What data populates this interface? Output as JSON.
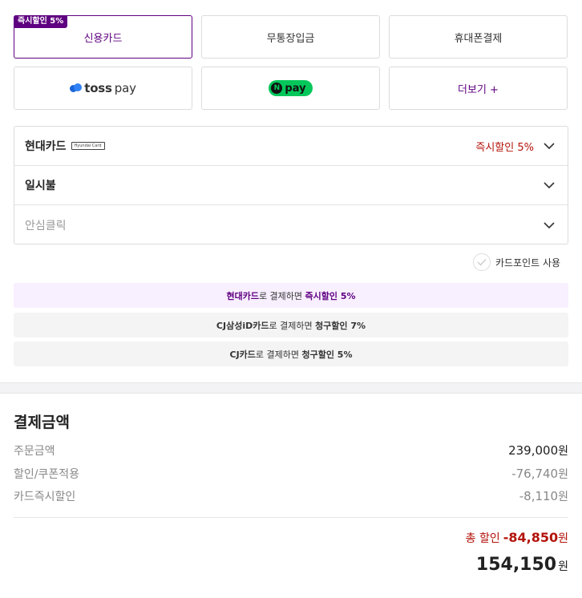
{
  "payment_methods": {
    "credit_card": "신용카드",
    "bank_transfer": "무통장입금",
    "mobile": "휴대폰결제",
    "toss_brand": "toss",
    "toss_suffix": "pay",
    "npay_letter": "N",
    "npay_text": "pay",
    "more": "더보기 +",
    "promo_badge": "즉시할인 5%"
  },
  "card_select": {
    "card_name": "현대카드",
    "card_logo_text": "Hyundai Card",
    "card_promo": "즉시할인 5%",
    "installment": "일시불",
    "auth_placeholder": "안심클릭"
  },
  "card_point": {
    "label": "카드포인트 사용"
  },
  "benefits": [
    {
      "strong1": "현대카드",
      "text1": "로 결제하면 ",
      "strong2": "즉시할인 5%"
    },
    {
      "strong1": "CJ삼성iD카드",
      "text1": "로 결제하면 ",
      "strong2": "청구할인 7%"
    },
    {
      "strong1": "CJ카드",
      "text1": "로 결제하면 ",
      "strong2": "청구할인 5%"
    }
  ],
  "summary": {
    "title": "결제금액",
    "order_label": "주문금액",
    "order_value": "239,000",
    "coupon_label": "할인/쿠폰적용",
    "coupon_value": "-76,740",
    "card_label": "카드즉시할인",
    "card_value": "-8,110",
    "won": "원",
    "total_discount_label": "총 할인",
    "total_discount_value": "-84,850",
    "total_value": "154,150"
  },
  "colors": {
    "brand_purple": "#5f0080",
    "discount_red": "#b3130b",
    "npay_green": "#03c75a",
    "toss_blue": "#3182f6"
  }
}
